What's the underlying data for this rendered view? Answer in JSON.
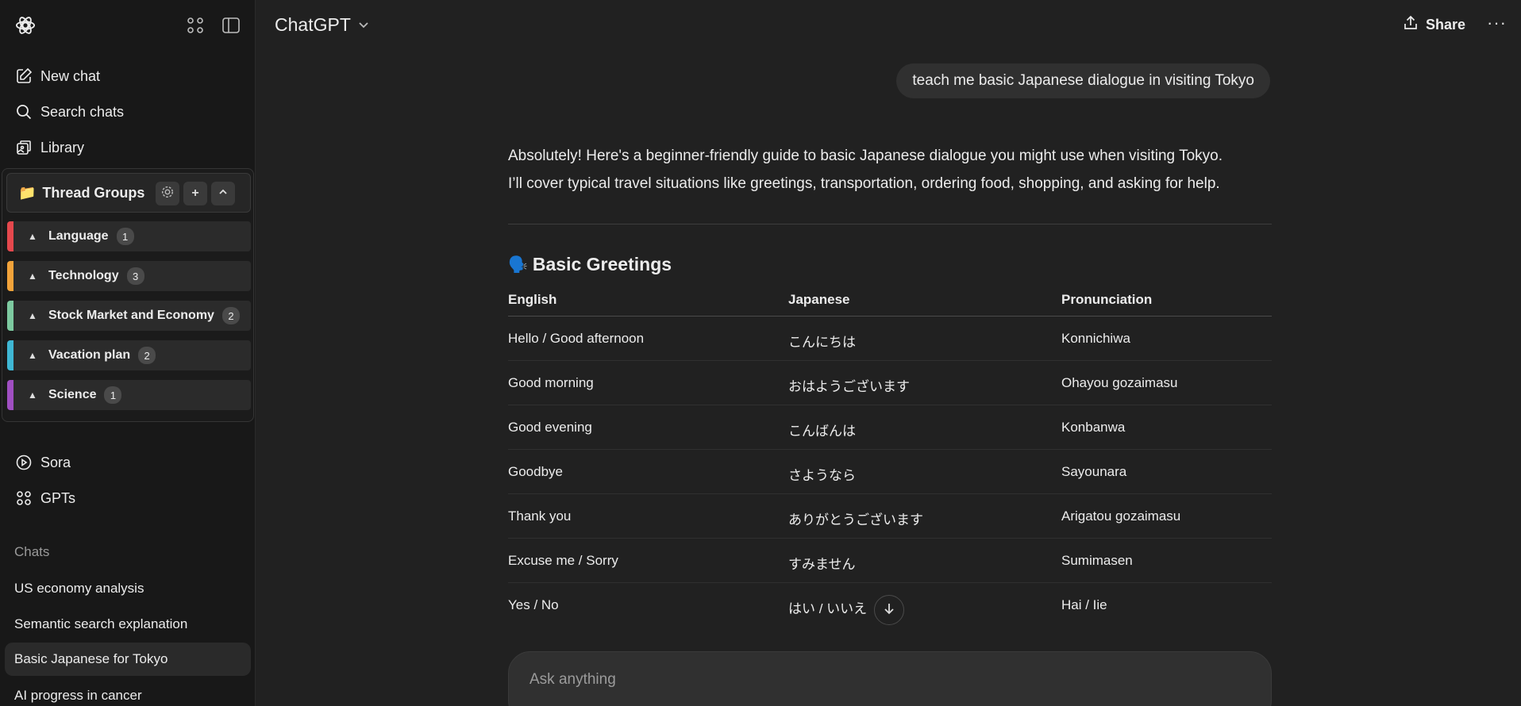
{
  "sidebar": {
    "nav": [
      {
        "label": "New chat",
        "icon": "new-chat-icon"
      },
      {
        "label": "Search chats",
        "icon": "search-icon"
      },
      {
        "label": "Library",
        "icon": "library-icon"
      }
    ],
    "thread_groups": {
      "title": "Thread Groups",
      "folder_icon": "📁",
      "add_label": "+",
      "collapse_label": "^",
      "groups": [
        {
          "name": "Language",
          "count": "1",
          "color": "#e5484d"
        },
        {
          "name": "Technology",
          "count": "3",
          "color": "#f2a33a"
        },
        {
          "name": "Stock Market and Economy",
          "count": "2",
          "color": "#7dcaa0"
        },
        {
          "name": "Vacation plan",
          "count": "2",
          "color": "#3fb7d4"
        },
        {
          "name": "Science",
          "count": "1",
          "color": "#a04fc2"
        }
      ]
    },
    "nav2": [
      {
        "label": "Sora",
        "icon": "play-circle-icon"
      },
      {
        "label": "GPTs",
        "icon": "grid-icon"
      }
    ],
    "chats_heading": "Chats",
    "chats": [
      {
        "label": "US economy analysis",
        "active": false
      },
      {
        "label": "Semantic search explanation",
        "active": false
      },
      {
        "label": "Basic Japanese for Tokyo",
        "active": true
      },
      {
        "label": "AI progress in cancer",
        "active": false
      }
    ]
  },
  "header": {
    "model": "ChatGPT",
    "share_label": "Share",
    "more_label": "···"
  },
  "conversation": {
    "user_message": "teach me basic Japanese dialogue in visiting Tokyo",
    "answer_line1": "Absolutely! Here's a beginner-friendly guide to basic Japanese dialogue you might use when visiting Tokyo.",
    "answer_line2": "I’ll cover typical travel situations like greetings, transportation, ordering food, shopping, and asking for help.",
    "section_emoji": "🗣️",
    "section_title": "Basic Greetings",
    "table": {
      "headers": [
        "English",
        "Japanese",
        "Pronunciation"
      ],
      "rows": [
        [
          "Hello / Good afternoon",
          "こんにちは",
          "Konnichiwa"
        ],
        [
          "Good morning",
          "おはようございます",
          "Ohayou gozaimasu"
        ],
        [
          "Good evening",
          "こんばんは",
          "Konbanwa"
        ],
        [
          "Goodbye",
          "さようなら",
          "Sayounara"
        ],
        [
          "Thank you",
          "ありがとうございます",
          "Arigatou gozaimasu"
        ],
        [
          "Excuse me / Sorry",
          "すみません",
          "Sumimasen"
        ],
        [
          "Yes / No",
          "はい / いいえ",
          "Hai / Iie"
        ]
      ]
    }
  },
  "composer": {
    "placeholder": "Ask anything"
  }
}
